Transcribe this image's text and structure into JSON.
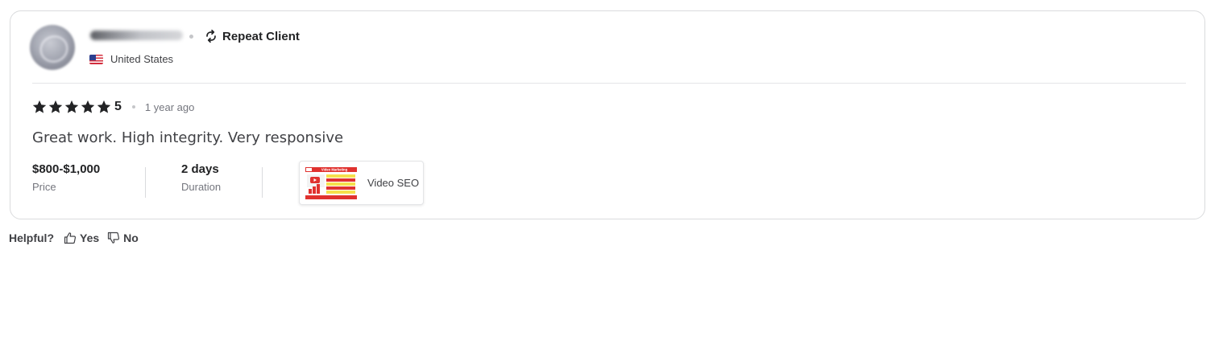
{
  "reviewer": {
    "name_redacted": true,
    "badge_label": "Repeat Client",
    "badge_icon": "repeat-icon",
    "country": "United States",
    "flag_icon": "us-flag-icon",
    "avatar": "blurred-avatar"
  },
  "review": {
    "rating": 5,
    "rating_label": "5",
    "max_stars": 5,
    "time_ago": "1 year ago",
    "text": "Great work. High integrity. Very responsive"
  },
  "order": {
    "price_value": "$800-$1,000",
    "price_label": "Price",
    "duration_value": "2 days",
    "duration_label": "Duration"
  },
  "gig": {
    "title": "Video SEO",
    "thumbnail_header": "Video Marketing"
  },
  "helpful": {
    "prompt": "Helpful?",
    "yes_label": "Yes",
    "no_label": "No",
    "yes_icon": "thumbs-up-icon",
    "no_icon": "thumbs-down-icon"
  },
  "colors": {
    "text_primary": "#222325",
    "text_secondary": "#74767e",
    "border": "#dadbdd",
    "thumb_red": "#e0322f",
    "thumb_yellow": "#f6e04c"
  }
}
